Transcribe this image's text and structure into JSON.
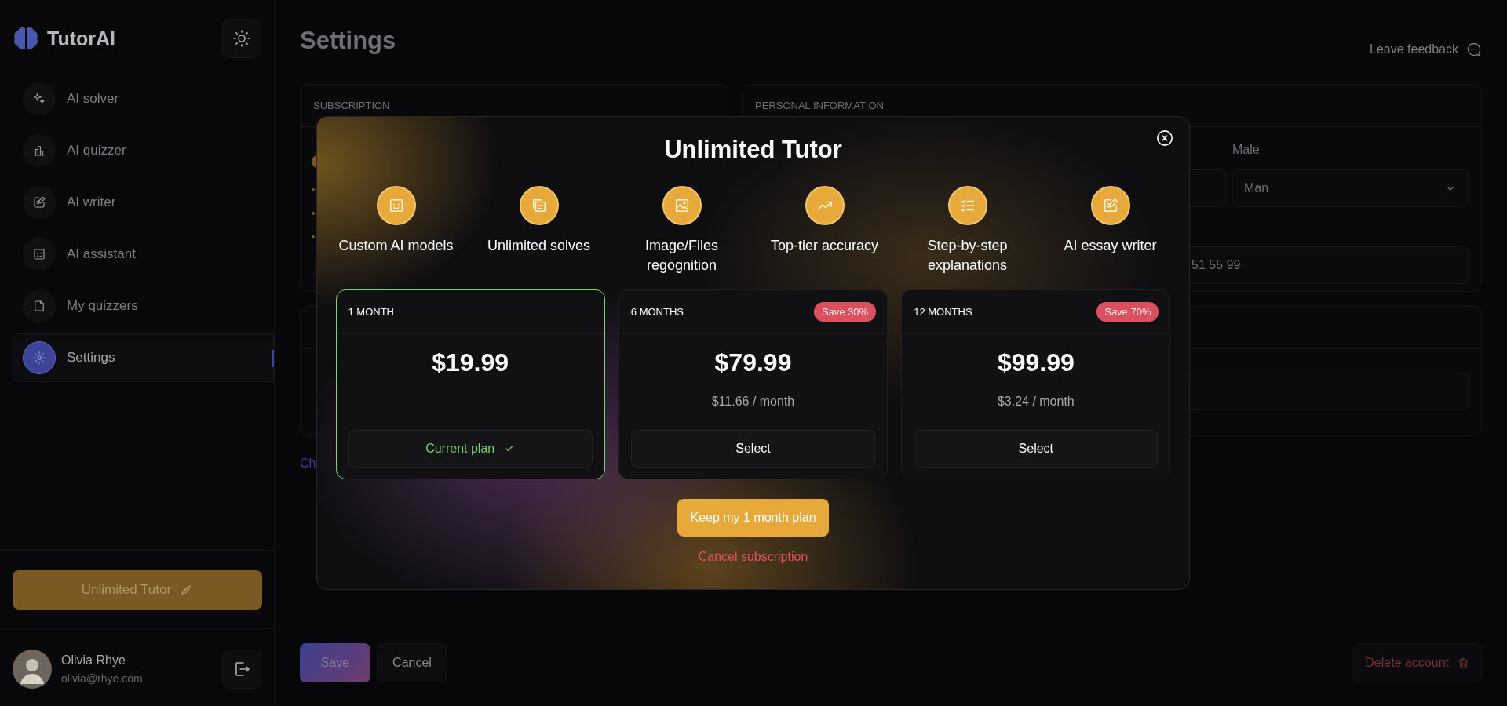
{
  "sidebar": {
    "logo": "TutorAI",
    "nav": [
      {
        "label": "AI solver",
        "selected": false
      },
      {
        "label": "AI quizzer",
        "selected": false
      },
      {
        "label": "AI writer",
        "selected": false
      },
      {
        "label": "AI assistant",
        "selected": false
      },
      {
        "label": "My quizzers",
        "selected": false
      },
      {
        "label": "Settings",
        "selected": true
      }
    ],
    "upgrade_button": "Unlimited Tutor",
    "user": {
      "name": "Olivia Rhye",
      "email": "olivia@rhye.com"
    }
  },
  "page": {
    "title": "Settings",
    "feedback_link": "Leave feedback",
    "subscription_card": {
      "title": "SUBSCRIPTION"
    },
    "personal_card": {
      "title": "PERSONAL INFORMATION",
      "gender_label": "Male",
      "gender_value": "Man",
      "phone_value": "51 55 99"
    },
    "link": "Ch",
    "save_button": "Save",
    "cancel_button": "Cancel",
    "delete_button": "Delete account"
  },
  "modal": {
    "title": "Unlimited Tutor",
    "features": [
      {
        "label": "Custom AI models"
      },
      {
        "label": "Unlimited solves"
      },
      {
        "label": "Image/Files regognition"
      },
      {
        "label": "Top-tier accuracy"
      },
      {
        "label": "Step-by-step explanations"
      },
      {
        "label": "AI essay writer"
      }
    ],
    "plans": [
      {
        "period": "1 MONTH",
        "price": "$19.99",
        "button": "Current plan",
        "selected": true
      },
      {
        "period": "6 MONTHS",
        "badge": "Save 30%",
        "price": "$79.99",
        "per_month": "$11.66 / month",
        "button": "Select",
        "selected": false
      },
      {
        "period": "12 MONTHS",
        "badge": "Save 70%",
        "price": "$99.99",
        "per_month": "$3.24 / month",
        "button": "Select",
        "selected": false
      }
    ],
    "keep_button": "Keep my 1 month plan",
    "cancel_link": "Cancel subscription"
  }
}
